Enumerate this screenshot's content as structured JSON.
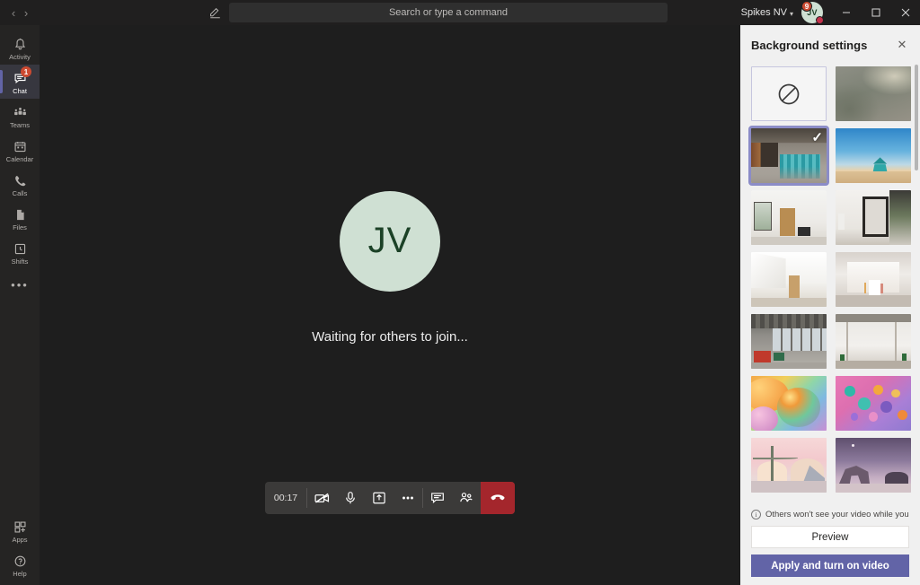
{
  "titlebar": {
    "back_label": "‹",
    "forward_label": "›",
    "compose_icon": "compose-icon",
    "search": {
      "placeholder": "Search or type a command",
      "value": ""
    },
    "org_name": "Spikes NV",
    "org_badge": "9",
    "avatar_initials": "JV",
    "presence": "busy",
    "minimize_label": "—",
    "maximize_label": "▢",
    "close_label": "✕"
  },
  "rail": {
    "items": [
      {
        "label": "Activity",
        "icon": "bell-icon",
        "badge": "",
        "selected": false
      },
      {
        "label": "Chat",
        "icon": "chat-icon",
        "badge": "1",
        "selected": true
      },
      {
        "label": "Teams",
        "icon": "teams-icon",
        "badge": "",
        "selected": false
      },
      {
        "label": "Calendar",
        "icon": "calendar-icon",
        "badge": "",
        "selected": false
      },
      {
        "label": "Calls",
        "icon": "phone-icon",
        "badge": "",
        "selected": false
      },
      {
        "label": "Files",
        "icon": "files-icon",
        "badge": "",
        "selected": false
      },
      {
        "label": "Shifts",
        "icon": "shifts-icon",
        "badge": "",
        "selected": false
      }
    ],
    "more_label": "•••",
    "bottom_items": [
      {
        "label": "Apps",
        "icon": "apps-icon"
      },
      {
        "label": "Help",
        "icon": "help-icon"
      }
    ]
  },
  "stage": {
    "avatar_initials": "JV",
    "status_text": "Waiting for others to join...",
    "avatar_bg": "#cfe0d3",
    "avatar_fg": "#1b4126"
  },
  "controls": {
    "timer": "00:17",
    "buttons": [
      {
        "name": "camera-off-button",
        "icon": "camera-off-icon",
        "label": "Camera"
      },
      {
        "name": "microphone-button",
        "icon": "microphone-icon",
        "label": "Mic"
      },
      {
        "name": "share-screen-button",
        "icon": "share-screen-icon",
        "label": "Share"
      },
      {
        "name": "more-options-button",
        "icon": "ellipsis-icon",
        "label": "More actions"
      },
      {
        "name": "chat-button",
        "icon": "chat-bubble-icon",
        "label": "Chat"
      },
      {
        "name": "participants-button",
        "icon": "people-icon",
        "label": "Participants"
      }
    ],
    "hangup": {
      "name": "hangup-button",
      "icon": "hangup-icon",
      "label": "Hang up",
      "color": "#a4262c"
    }
  },
  "panel": {
    "title": "Background settings",
    "close_label": "✕",
    "notice": "Others won't see your video while you previe...",
    "preview_label": "Preview",
    "apply_label": "Apply and turn on video",
    "accent_color": "#6264a7",
    "selected_index": 2,
    "thumbnails": [
      {
        "name": "None",
        "kind": "none"
      },
      {
        "name": "Blur",
        "kind": "blur"
      },
      {
        "name": "Office with teal lockers",
        "kind": "office-lockers"
      },
      {
        "name": "Beach lifeguard tower",
        "kind": "beach"
      },
      {
        "name": "White room with window",
        "kind": "white-room-window"
      },
      {
        "name": "Room with large mirror",
        "kind": "room-mirror"
      },
      {
        "name": "Bright white stairwell",
        "kind": "white-stairwell"
      },
      {
        "name": "Minimal white studio",
        "kind": "white-studio"
      },
      {
        "name": "Open-plan loft office",
        "kind": "loft-office"
      },
      {
        "name": "Plain wall with plants",
        "kind": "plain-wall"
      },
      {
        "name": "Orange and pink balloons",
        "kind": "balloons-large"
      },
      {
        "name": "Floating colourful spheres",
        "kind": "balloons-small"
      },
      {
        "name": "Golden Gate bridge illustration",
        "kind": "bridge"
      },
      {
        "name": "Desert arch illustration",
        "kind": "desert-arch"
      }
    ]
  }
}
